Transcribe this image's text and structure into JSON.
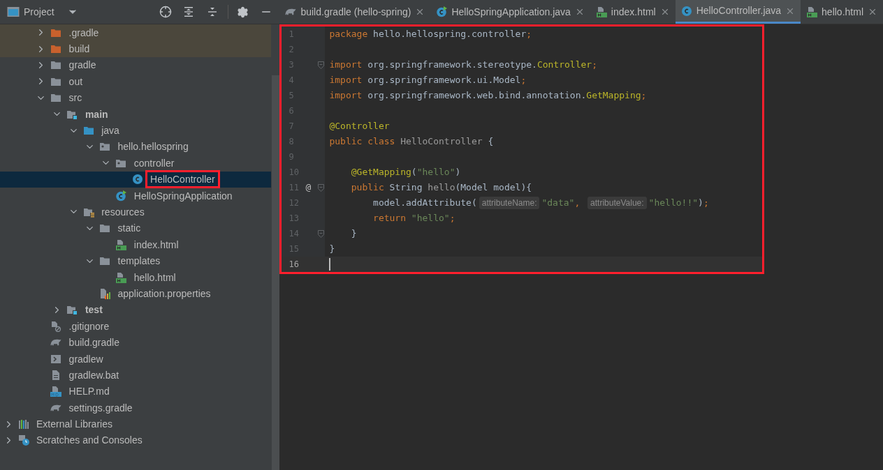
{
  "project_panel": {
    "title": "Project",
    "tree": [
      {
        "label": ".gradle",
        "kind": "folder",
        "expanded": false,
        "excluded": true
      },
      {
        "label": "build",
        "kind": "folder",
        "expanded": false,
        "excluded": true
      },
      {
        "label": "gradle",
        "kind": "folder",
        "expanded": false,
        "excluded": false
      },
      {
        "label": "out",
        "kind": "folder",
        "expanded": false,
        "excluded": false
      },
      {
        "label": "src",
        "kind": "folder",
        "expanded": true,
        "excluded": false,
        "children": [
          {
            "label": "main",
            "kind": "module",
            "bold": true,
            "expanded": true,
            "children": [
              {
                "label": "java",
                "kind": "source",
                "expanded": true,
                "children": [
                  {
                    "label": "hello.hellospring",
                    "kind": "package",
                    "expanded": true,
                    "children": [
                      {
                        "label": "controller",
                        "kind": "package",
                        "expanded": true,
                        "children": [
                          {
                            "label": "HelloController",
                            "kind": "class",
                            "selected": true,
                            "highlighted": true
                          }
                        ]
                      },
                      {
                        "label": "HelloSpringApplication",
                        "kind": "spring",
                        "selected": false
                      }
                    ]
                  }
                ]
              },
              {
                "label": "resources",
                "kind": "resources",
                "expanded": true,
                "children": [
                  {
                    "label": "static",
                    "kind": "folder",
                    "expanded": true,
                    "children": [
                      {
                        "label": "index.html",
                        "kind": "html",
                        "selected": false
                      }
                    ]
                  },
                  {
                    "label": "templates",
                    "kind": "folder",
                    "expanded": true,
                    "children": [
                      {
                        "label": "hello.html",
                        "kind": "html",
                        "selected": false
                      }
                    ]
                  },
                  {
                    "label": "application.properties",
                    "kind": "properties",
                    "selected": false
                  }
                ]
              }
            ]
          },
          {
            "label": "test",
            "kind": "module",
            "bold": true,
            "expanded": false
          }
        ]
      },
      {
        "label": ".gitignore",
        "kind": "ignore",
        "selected": false
      },
      {
        "label": "build.gradle",
        "kind": "gradle",
        "selected": false
      },
      {
        "label": "gradlew",
        "kind": "shell",
        "selected": false
      },
      {
        "label": "gradlew.bat",
        "kind": "text",
        "selected": false
      },
      {
        "label": "HELP.md",
        "kind": "md",
        "selected": false
      },
      {
        "label": "settings.gradle",
        "kind": "gradle",
        "selected": false
      }
    ],
    "root_items": [
      {
        "label": "External Libraries",
        "kind": "library",
        "expanded": false
      },
      {
        "label": "Scratches and Consoles",
        "kind": "scratch",
        "expanded": false
      }
    ]
  },
  "tabs": [
    {
      "label": "build.gradle (hello-spring)",
      "kind": "gradle",
      "selected": false
    },
    {
      "label": "HelloSpringApplication.java",
      "kind": "spring",
      "selected": false
    },
    {
      "label": "index.html",
      "kind": "html",
      "selected": false
    },
    {
      "label": "HelloController.java",
      "kind": "class",
      "selected": true
    },
    {
      "label": "hello.html",
      "kind": "html",
      "selected": false
    }
  ],
  "editor": {
    "highlighted": true,
    "lines": [
      {
        "number": "1",
        "tokens": [
          {
            "kind": "keyword",
            "text": "package "
          },
          {
            "kind": "plain",
            "text": "hello.hellospring.controller"
          },
          {
            "kind": "keyword",
            "text": ";"
          }
        ]
      },
      {
        "number": "2"
      },
      {
        "number": "3",
        "fold": true,
        "tokens": [
          {
            "kind": "keyword",
            "text": "import "
          },
          {
            "kind": "plain",
            "text": "org.springframework.stereotype."
          },
          {
            "kind": "annotation",
            "text": "Controller"
          },
          {
            "kind": "keyword",
            "text": ";"
          }
        ]
      },
      {
        "number": "4",
        "tokens": [
          {
            "kind": "keyword",
            "text": "import "
          },
          {
            "kind": "plain",
            "text": "org.springframework.ui.Model"
          },
          {
            "kind": "keyword",
            "text": ";"
          }
        ]
      },
      {
        "number": "5",
        "tokens": [
          {
            "kind": "keyword",
            "text": "import "
          },
          {
            "kind": "plain",
            "text": "org.springframework.web.bind.annotation."
          },
          {
            "kind": "annotation",
            "text": "GetMapping"
          },
          {
            "kind": "keyword",
            "text": ";"
          }
        ]
      },
      {
        "number": "6"
      },
      {
        "number": "7",
        "tokens": [
          {
            "kind": "annotation",
            "text": "@Controller"
          }
        ]
      },
      {
        "number": "8",
        "tokens": [
          {
            "kind": "keyword",
            "text": "public class "
          },
          {
            "kind": "dim",
            "text": "HelloController "
          },
          {
            "kind": "plain",
            "text": "{"
          }
        ]
      },
      {
        "number": "9"
      },
      {
        "number": "10",
        "tokens": [
          {
            "kind": "annotation",
            "text": "    @GetMapping"
          },
          {
            "kind": "plain",
            "text": "("
          },
          {
            "kind": "string",
            "text": "\"hello\""
          },
          {
            "kind": "plain",
            "text": ")"
          }
        ]
      },
      {
        "number": "11",
        "marker": "@",
        "fold": true,
        "tokens": [
          {
            "kind": "keyword",
            "text": "    public "
          },
          {
            "kind": "plain",
            "text": "String "
          },
          {
            "kind": "dim",
            "text": "hello"
          },
          {
            "kind": "plain",
            "text": "(Model model){"
          }
        ]
      },
      {
        "number": "12",
        "tokens": [
          {
            "kind": "plain",
            "text": "        model.addAttribute("
          },
          {
            "kind": "hint",
            "text": "attributeName:"
          },
          {
            "kind": "string",
            "text": "\"data\""
          },
          {
            "kind": "keyword",
            "text": ", "
          },
          {
            "kind": "hint",
            "text": "attributeValue:"
          },
          {
            "kind": "string",
            "text": "\"hello!!\""
          },
          {
            "kind": "plain",
            "text": ")"
          },
          {
            "kind": "keyword",
            "text": ";"
          }
        ]
      },
      {
        "number": "13",
        "tokens": [
          {
            "kind": "keyword",
            "text": "        return "
          },
          {
            "kind": "string",
            "text": "\"hello\""
          },
          {
            "kind": "keyword",
            "text": ";"
          }
        ]
      },
      {
        "number": "14",
        "fold": true,
        "tokens": [
          {
            "kind": "plain",
            "text": "    }"
          }
        ]
      },
      {
        "number": "15",
        "tokens": [
          {
            "kind": "plain",
            "text": "}"
          }
        ]
      },
      {
        "number": "16",
        "current": true
      }
    ]
  }
}
